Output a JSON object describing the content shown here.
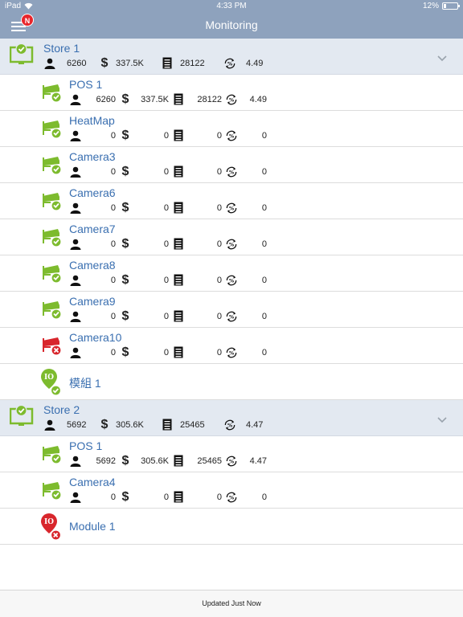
{
  "status_bar": {
    "device": "iPad",
    "time": "4:33 PM",
    "battery": "12%"
  },
  "nav": {
    "title": "Monitoring",
    "badge": "N"
  },
  "stores": [
    {
      "name": "Store 1",
      "people": "6260",
      "revenue": "337.5K",
      "transactions": "28122",
      "conversion": "4.49",
      "items": [
        {
          "kind": "camera",
          "status": "ok",
          "name": "POS 1",
          "people": "6260",
          "revenue": "337.5K",
          "transactions": "28122",
          "conversion": "4.49"
        },
        {
          "kind": "camera",
          "status": "ok",
          "name": "HeatMap",
          "people": "0",
          "revenue": "0",
          "transactions": "0",
          "conversion": "0"
        },
        {
          "kind": "camera",
          "status": "ok",
          "name": "Camera3",
          "people": "0",
          "revenue": "0",
          "transactions": "0",
          "conversion": "0"
        },
        {
          "kind": "camera",
          "status": "ok",
          "name": "Camera6",
          "people": "0",
          "revenue": "0",
          "transactions": "0",
          "conversion": "0"
        },
        {
          "kind": "camera",
          "status": "ok",
          "name": "Camera7",
          "people": "0",
          "revenue": "0",
          "transactions": "0",
          "conversion": "0"
        },
        {
          "kind": "camera",
          "status": "ok",
          "name": "Camera8",
          "people": "0",
          "revenue": "0",
          "transactions": "0",
          "conversion": "0"
        },
        {
          "kind": "camera",
          "status": "ok",
          "name": "Camera9",
          "people": "0",
          "revenue": "0",
          "transactions": "0",
          "conversion": "0"
        },
        {
          "kind": "camera",
          "status": "error",
          "name": "Camera10",
          "people": "0",
          "revenue": "0",
          "transactions": "0",
          "conversion": "0"
        },
        {
          "kind": "module",
          "status": "ok",
          "name": "模組 1",
          "icon_text": "IO"
        }
      ]
    },
    {
      "name": "Store 2",
      "people": "5692",
      "revenue": "305.6K",
      "transactions": "25465",
      "conversion": "4.47",
      "items": [
        {
          "kind": "camera",
          "status": "ok",
          "name": "POS 1",
          "people": "5692",
          "revenue": "305.6K",
          "transactions": "25465",
          "conversion": "4.47"
        },
        {
          "kind": "camera",
          "status": "ok",
          "name": "Camera4",
          "people": "0",
          "revenue": "0",
          "transactions": "0",
          "conversion": "0"
        },
        {
          "kind": "module",
          "status": "error",
          "name": "Module 1",
          "icon_text": "IO"
        }
      ]
    }
  ],
  "footer": {
    "text": "Updated Just Now"
  },
  "colors": {
    "nav": "#8ea2bd",
    "store_bg": "#e3e9f1",
    "ok": "#7dbb2e",
    "error": "#d8262c",
    "link": "#3a6fb0"
  },
  "icons": {
    "people": "person-icon",
    "revenue": "dollar-icon",
    "transactions": "receipt-icon",
    "conversion": "conversion-rate-icon"
  }
}
